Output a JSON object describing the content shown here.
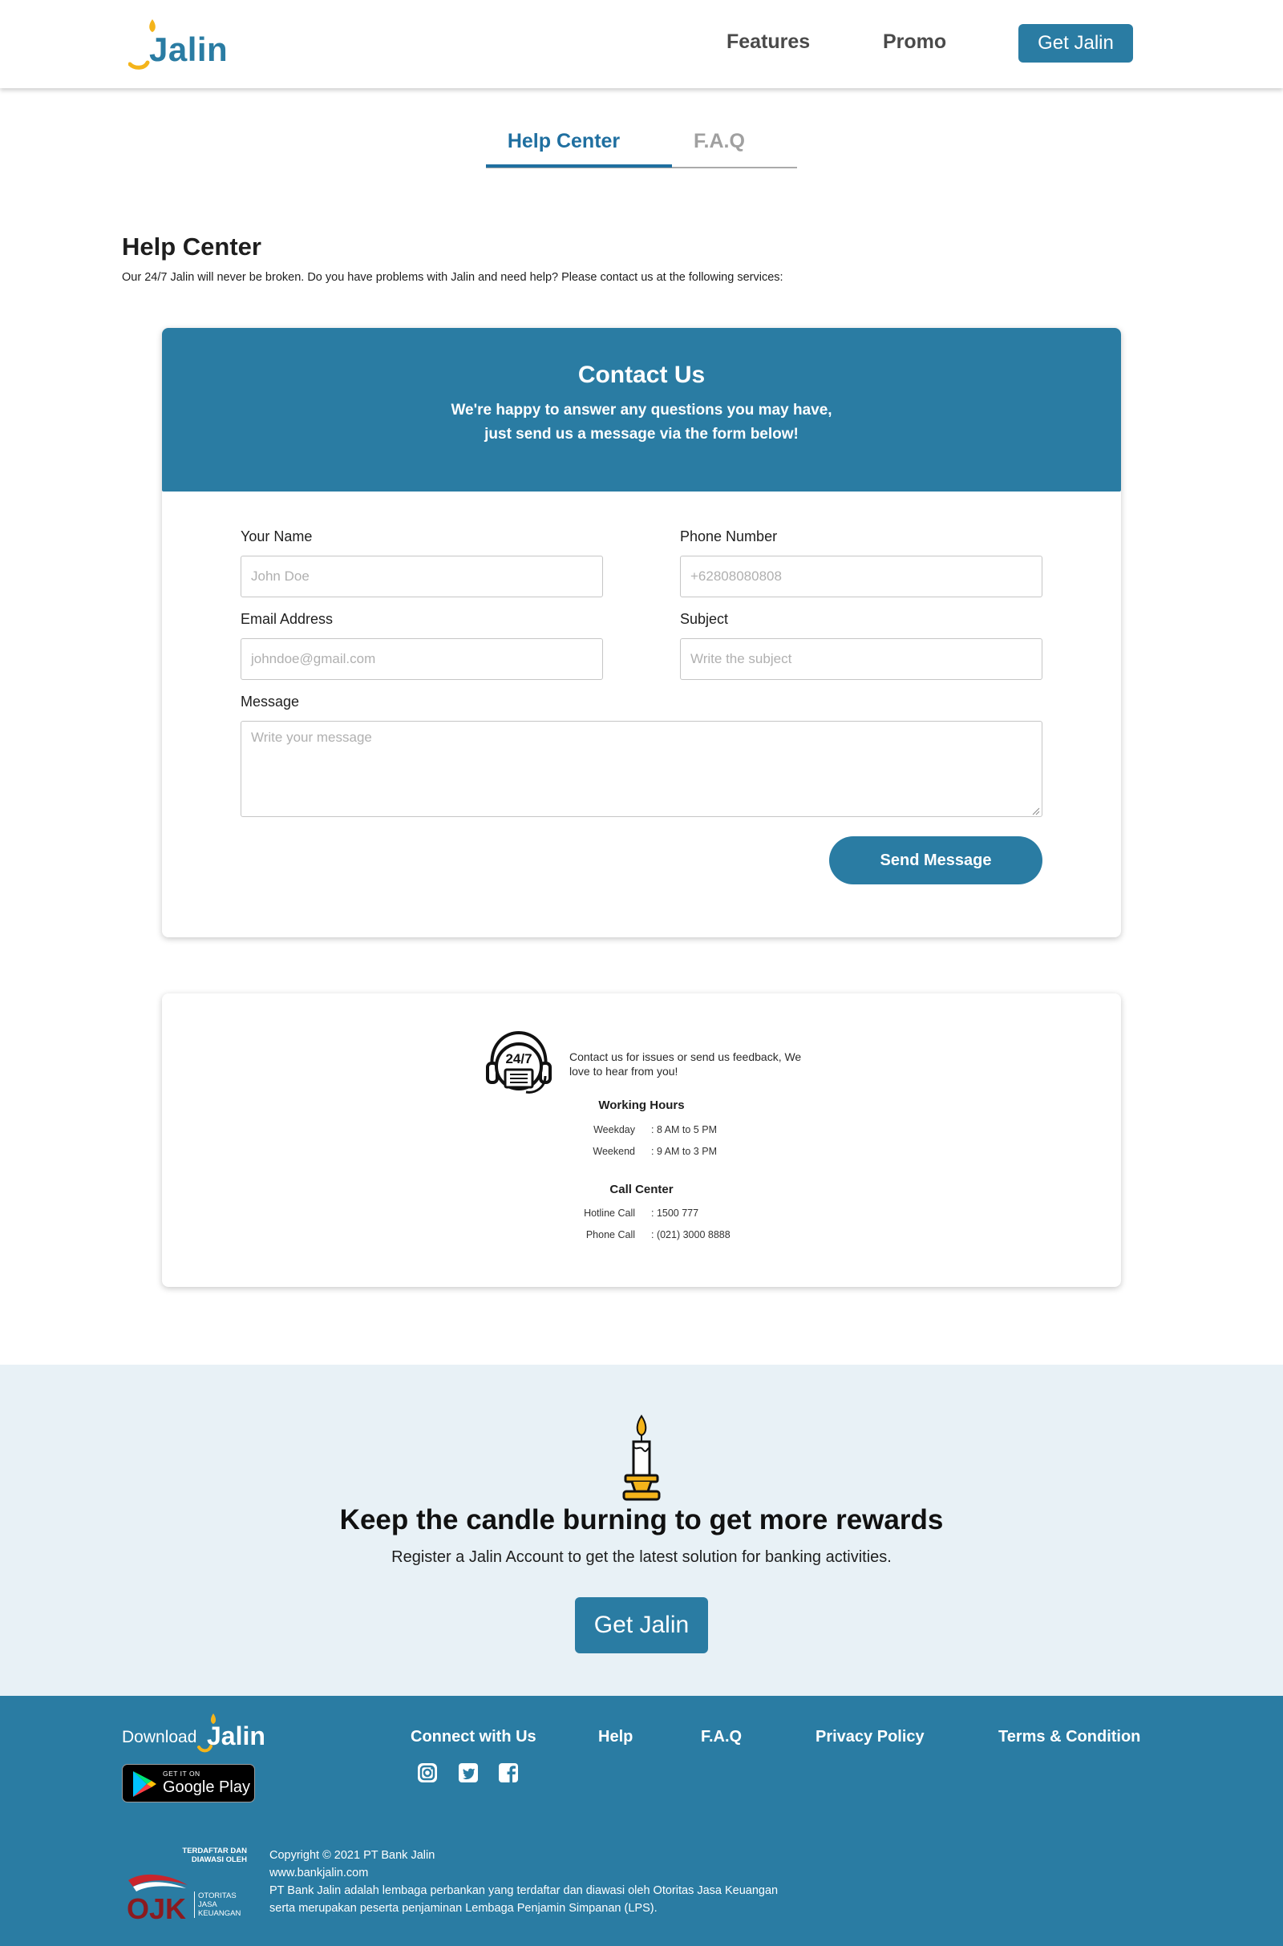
{
  "header": {
    "logo_text": "Jalin",
    "nav": {
      "features": "Features",
      "promo": "Promo"
    },
    "cta_label": "Get Jalin"
  },
  "tabs": {
    "help_center": "Help Center",
    "faq": "F.A.Q"
  },
  "intro": {
    "title": "Help Center",
    "description": "Our 24/7 Jalin will never be broken. Do you have problems with Jalin and need help? Please contact us at the following services:"
  },
  "contact": {
    "title": "Contact Us",
    "subtitle_line1": "We're happy to answer any questions you may have,",
    "subtitle_line2": "just send us a message via the form below!",
    "name": {
      "label": "Your Name",
      "placeholder": "John Doe"
    },
    "phone": {
      "label": "Phone Number",
      "placeholder": "+62808080808"
    },
    "email": {
      "label": "Email Address",
      "placeholder": "johndoe@gmail.com"
    },
    "subject": {
      "label": "Subject",
      "placeholder": "Write the subject"
    },
    "message": {
      "label": "Message",
      "placeholder": "Write your message"
    },
    "send_label": "Send Message"
  },
  "info": {
    "badge": "24/7",
    "text": "Contact us for issues or send us feedback, We love to hear from you!",
    "working_hours": {
      "title": "Working Hours",
      "rows": [
        {
          "label": "Weekday",
          "value": ": 8 AM to 5 PM"
        },
        {
          "label": "Weekend",
          "value": ": 9 AM to 3 PM"
        }
      ]
    },
    "call_center": {
      "title": "Call Center",
      "rows": [
        {
          "label": "Hotline Call",
          "value": ": 1500 777"
        },
        {
          "label": "Phone Call",
          "value": ": (021) 3000 8888"
        }
      ]
    }
  },
  "cta": {
    "title": "Keep the candle burning to get more rewards",
    "subtitle": "Register a Jalin Account to get the latest solution for banking activities.",
    "button_label": "Get Jalin"
  },
  "footer": {
    "download_label": "Download",
    "logo_text": "Jalin",
    "gplay_top": "GET IT ON",
    "gplay_main": "Google Play",
    "nav": {
      "connect": "Connect with Us",
      "help": "Help",
      "faq": "F.A.Q",
      "privacy": "Privacy Policy",
      "terms": "Terms & Condition"
    },
    "social_icons": [
      "instagram-icon",
      "twitter-icon",
      "facebook-icon"
    ],
    "ojk": {
      "registered_line1": "TERDAFTAR DAN",
      "registered_line2": "DIAWASI OLEH",
      "logo_text": "OJK",
      "name_line1": "OTORITAS",
      "name_line2": "JASA",
      "name_line3": "KEUANGAN"
    },
    "copyright": "Copyright © 2021 PT Bank Jalin",
    "website": "www.bankjalin.com",
    "legal_line1": "PT Bank Jalin adalah lembaga perbankan yang terdaftar dan diawasi oleh Otoritas Jasa Keuangan",
    "legal_line2": "serta merupakan peserta penjaminan Lembaga Penjamin Simpanan (LPS)."
  },
  "colors": {
    "brand": "#2a7ca3",
    "tab_active": "#1f6fa0",
    "cta_background": "#e8f1f6",
    "candle_flame": "#f4b41a"
  }
}
